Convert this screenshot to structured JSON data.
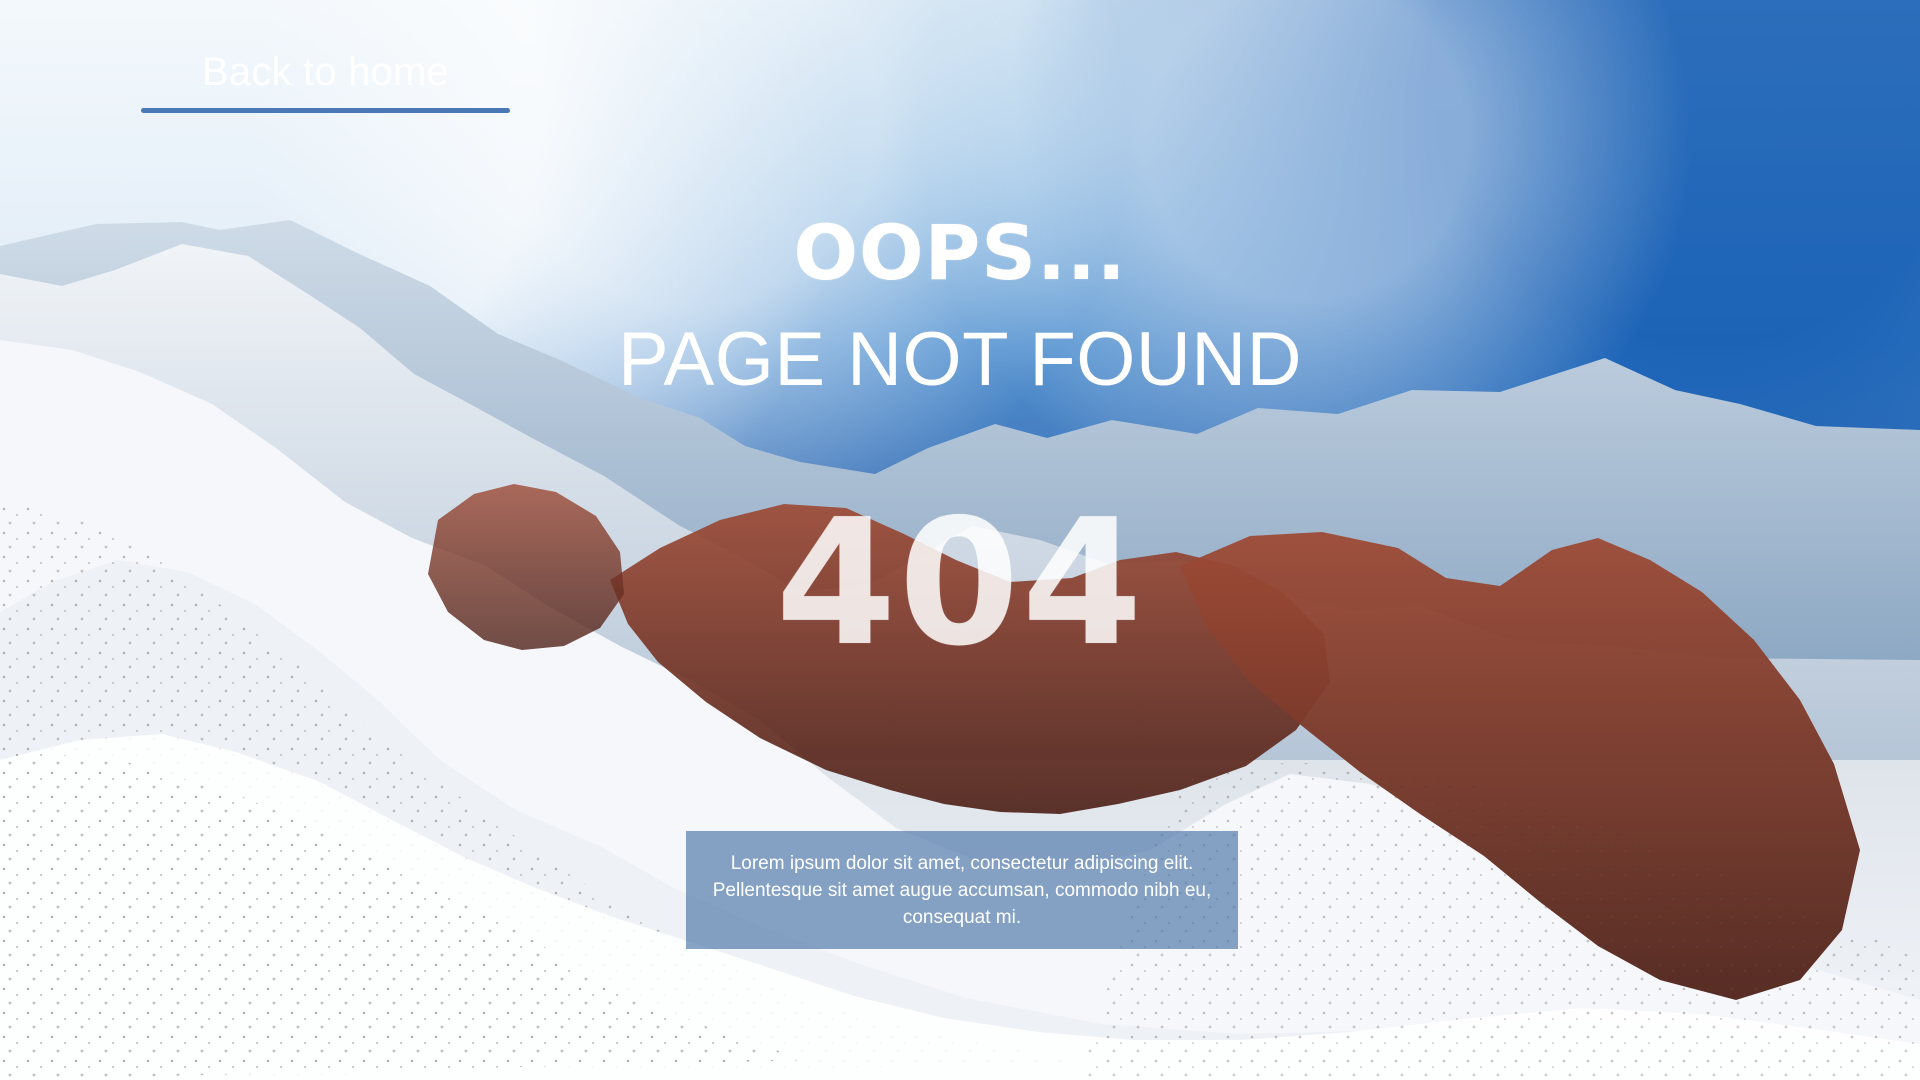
{
  "navigation": {
    "back_label": "Back to home"
  },
  "hero": {
    "headline": "OOPS...",
    "subheadline": "PAGE NOT FOUND",
    "error_code": "404",
    "message": "Lorem ipsum dolor sit amet, consectetur adipiscing elit. Pellentesque sit amet augue accumsan, commodo nibh eu, consequat mi."
  },
  "colors": {
    "text": "#ffffff",
    "underline": "#4a78b4",
    "message_panel": "#4e78aa",
    "sky_dark": "#135bb2",
    "snow": "#f2f4f7"
  }
}
